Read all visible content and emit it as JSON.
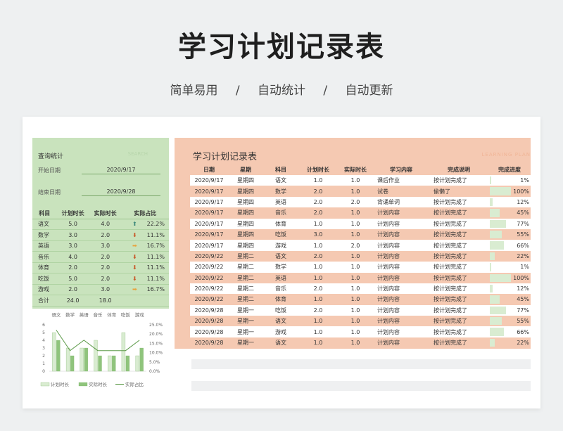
{
  "title": "学习计划记录表",
  "subtitle": [
    "简单易用",
    "/",
    "自动统计",
    "/",
    "自动更新"
  ],
  "left": {
    "title": "查询统计",
    "watermark": "SEARCH",
    "start_label": "开始日期",
    "start_value": "2020/9/17",
    "end_label": "结束日期",
    "end_value": "2020/9/28",
    "headers": [
      "科目",
      "计划时长",
      "实际时长",
      "实际占比"
    ],
    "rows": [
      {
        "subject": "语文",
        "plan": "5.0",
        "actual": "4.0",
        "icon": "up-arrow-icon",
        "ratio": "22.2%"
      },
      {
        "subject": "数学",
        "plan": "3.0",
        "actual": "2.0",
        "icon": "down-arrow-icon",
        "ratio": "11.1%"
      },
      {
        "subject": "英语",
        "plan": "3.0",
        "actual": "3.0",
        "icon": "right-arrow-icon",
        "ratio": "16.7%"
      },
      {
        "subject": "音乐",
        "plan": "4.0",
        "actual": "2.0",
        "icon": "down-arrow-icon",
        "ratio": "11.1%"
      },
      {
        "subject": "体育",
        "plan": "2.0",
        "actual": "2.0",
        "icon": "down-arrow-icon",
        "ratio": "11.1%"
      },
      {
        "subject": "吃饭",
        "plan": "5.0",
        "actual": "2.0",
        "icon": "down-arrow-icon",
        "ratio": "11.1%"
      },
      {
        "subject": "游戏",
        "plan": "2.0",
        "actual": "3.0",
        "icon": "right-arrow-icon",
        "ratio": "16.7%"
      }
    ],
    "total_label": "合计",
    "total_plan": "24.0",
    "total_actual": "18.0"
  },
  "chart_data": {
    "type": "bar",
    "categories": [
      "语文",
      "数学",
      "英语",
      "音乐",
      "体育",
      "吃饭",
      "游戏"
    ],
    "series": [
      {
        "name": "计划时长",
        "kind": "bar",
        "values": [
          5,
          3,
          3,
          4,
          2,
          5,
          2
        ],
        "color": "#d9ecd1"
      },
      {
        "name": "实际时长",
        "kind": "bar",
        "values": [
          4,
          2,
          3,
          2,
          2,
          2,
          3
        ],
        "color": "#8fc47c"
      },
      {
        "name": "实际占比",
        "kind": "line",
        "axis": "right",
        "values": [
          22.2,
          11.1,
          16.7,
          11.1,
          11.1,
          11.1,
          16.7
        ],
        "color": "#5c9a48"
      }
    ],
    "yticks_left": [
      "6",
      "5",
      "4",
      "3",
      "2",
      "1",
      "0"
    ],
    "yticks_right": [
      "25.0%",
      "20.0%",
      "15.0%",
      "10.0%",
      "5.0%",
      "0.0%"
    ],
    "ylim_left": [
      0,
      6
    ],
    "ylim_right": [
      0,
      25
    ]
  },
  "right": {
    "title": "学习计划记录表",
    "watermark": "LEARNING PLAN",
    "headers": [
      "日期",
      "星期",
      "科目",
      "计划时长",
      "实际时长",
      "学习内容",
      "完成说明",
      "完成进度"
    ],
    "rows": [
      {
        "date": "2020/9/17",
        "week": "星期四",
        "subject": "语文",
        "plan": "1.0",
        "actual": "1.0",
        "content": "课后作业",
        "note": "按计划完成了",
        "progress": "1%",
        "pct": 1
      },
      {
        "date": "2020/9/17",
        "week": "星期四",
        "subject": "数学",
        "plan": "2.0",
        "actual": "1.0",
        "content": "试卷",
        "note": "偷懒了",
        "progress": "100%",
        "pct": 100
      },
      {
        "date": "2020/9/17",
        "week": "星期四",
        "subject": "英语",
        "plan": "2.0",
        "actual": "2.0",
        "content": "背诵单词",
        "note": "按计划完成了",
        "progress": "12%",
        "pct": 12
      },
      {
        "date": "2020/9/17",
        "week": "星期四",
        "subject": "音乐",
        "plan": "2.0",
        "actual": "1.0",
        "content": "计划内容",
        "note": "按计划完成了",
        "progress": "45%",
        "pct": 45
      },
      {
        "date": "2020/9/17",
        "week": "星期四",
        "subject": "体育",
        "plan": "1.0",
        "actual": "1.0",
        "content": "计划内容",
        "note": "按计划完成了",
        "progress": "77%",
        "pct": 77
      },
      {
        "date": "2020/9/17",
        "week": "星期四",
        "subject": "吃饭",
        "plan": "3.0",
        "actual": "1.0",
        "content": "计划内容",
        "note": "按计划完成了",
        "progress": "55%",
        "pct": 55
      },
      {
        "date": "2020/9/17",
        "week": "星期四",
        "subject": "游戏",
        "plan": "1.0",
        "actual": "2.0",
        "content": "计划内容",
        "note": "按计划完成了",
        "progress": "66%",
        "pct": 66
      },
      {
        "date": "2020/9/22",
        "week": "星期二",
        "subject": "语文",
        "plan": "2.0",
        "actual": "1.0",
        "content": "计划内容",
        "note": "按计划完成了",
        "progress": "22%",
        "pct": 22
      },
      {
        "date": "2020/9/22",
        "week": "星期二",
        "subject": "数学",
        "plan": "1.0",
        "actual": "1.0",
        "content": "计划内容",
        "note": "按计划完成了",
        "progress": "1%",
        "pct": 1
      },
      {
        "date": "2020/9/22",
        "week": "星期二",
        "subject": "英语",
        "plan": "1.0",
        "actual": "1.0",
        "content": "计划内容",
        "note": "按计划完成了",
        "progress": "100%",
        "pct": 100
      },
      {
        "date": "2020/9/22",
        "week": "星期二",
        "subject": "音乐",
        "plan": "2.0",
        "actual": "1.0",
        "content": "计划内容",
        "note": "按计划完成了",
        "progress": "12%",
        "pct": 12
      },
      {
        "date": "2020/9/22",
        "week": "星期二",
        "subject": "体育",
        "plan": "1.0",
        "actual": "1.0",
        "content": "计划内容",
        "note": "按计划完成了",
        "progress": "45%",
        "pct": 45
      },
      {
        "date": "2020/9/28",
        "week": "星期一",
        "subject": "吃饭",
        "plan": "2.0",
        "actual": "1.0",
        "content": "计划内容",
        "note": "按计划完成了",
        "progress": "77%",
        "pct": 77
      },
      {
        "date": "2020/9/28",
        "week": "星期一",
        "subject": "语文",
        "plan": "1.0",
        "actual": "1.0",
        "content": "计划内容",
        "note": "按计划完成了",
        "progress": "55%",
        "pct": 55
      },
      {
        "date": "2020/9/28",
        "week": "星期一",
        "subject": "游戏",
        "plan": "1.0",
        "actual": "1.0",
        "content": "计划内容",
        "note": "按计划完成了",
        "progress": "66%",
        "pct": 66
      },
      {
        "date": "2020/9/28",
        "week": "星期一",
        "subject": "语文",
        "plan": "1.0",
        "actual": "1.0",
        "content": "计划内容",
        "note": "按计划完成了",
        "progress": "22%",
        "pct": 22
      }
    ]
  },
  "colors": {
    "left_bg": "#c9e3bd",
    "right_bg": "#f5c9b2",
    "arrow_up": "#3e8a7c",
    "arrow_down": "#c85a2a",
    "arrow_side": "#e8a23a"
  }
}
